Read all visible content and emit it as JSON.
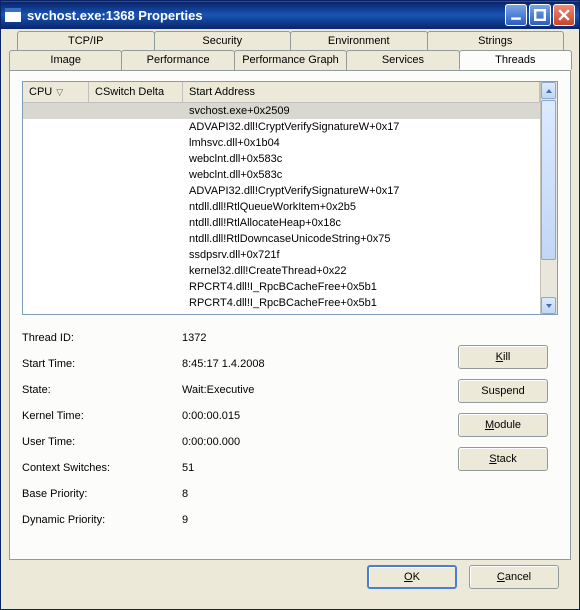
{
  "window": {
    "title": "svchost.exe:1368 Properties"
  },
  "tabs_row1": [
    {
      "label": "TCP/IP"
    },
    {
      "label": "Security"
    },
    {
      "label": "Environment"
    },
    {
      "label": "Strings"
    }
  ],
  "tabs_row2": [
    {
      "label": "Image"
    },
    {
      "label": "Performance"
    },
    {
      "label": "Performance Graph"
    },
    {
      "label": "Services"
    },
    {
      "label": "Threads"
    }
  ],
  "active_tab": "Threads",
  "columns": {
    "cpu": "CPU",
    "cswitch": "CSwitch Delta",
    "start": "Start Address"
  },
  "rows": [
    {
      "start": "svchost.exe+0x2509",
      "selected": true
    },
    {
      "start": "ADVAPI32.dll!CryptVerifySignatureW+0x17"
    },
    {
      "start": "lmhsvc.dll+0x1b04"
    },
    {
      "start": "webclnt.dll+0x583c"
    },
    {
      "start": "webclnt.dll+0x583c"
    },
    {
      "start": "ADVAPI32.dll!CryptVerifySignatureW+0x17"
    },
    {
      "start": "ntdll.dll!RtlQueueWorkItem+0x2b5"
    },
    {
      "start": "ntdll.dll!RtlAllocateHeap+0x18c"
    },
    {
      "start": "ntdll.dll!RtlDowncaseUnicodeString+0x75"
    },
    {
      "start": "ssdpsrv.dll+0x721f"
    },
    {
      "start": "kernel32.dll!CreateThread+0x22"
    },
    {
      "start": "RPCRT4.dll!I_RpcBCacheFree+0x5b1"
    },
    {
      "start": "RPCRT4.dll!I_RpcBCacheFree+0x5b1"
    }
  ],
  "details": {
    "thread_id_label": "Thread ID:",
    "thread_id": "1372",
    "start_time_label": "Start Time:",
    "start_time": "8:45:17  1.4.2008",
    "state_label": "State:",
    "state": "Wait:Executive",
    "kernel_time_label": "Kernel Time:",
    "kernel_time": "0:00:00.015",
    "user_time_label": "User Time:",
    "user_time": "0:00:00.000",
    "context_switches_label": "Context Switches:",
    "context_switches": "51",
    "base_priority_label": "Base Priority:",
    "base_priority": "8",
    "dynamic_priority_label": "Dynamic Priority:",
    "dynamic_priority": "9"
  },
  "buttons": {
    "kill": "Kill",
    "suspend": "Suspend",
    "module": "Module",
    "stack": "Stack",
    "ok": "OK",
    "cancel": "Cancel"
  }
}
